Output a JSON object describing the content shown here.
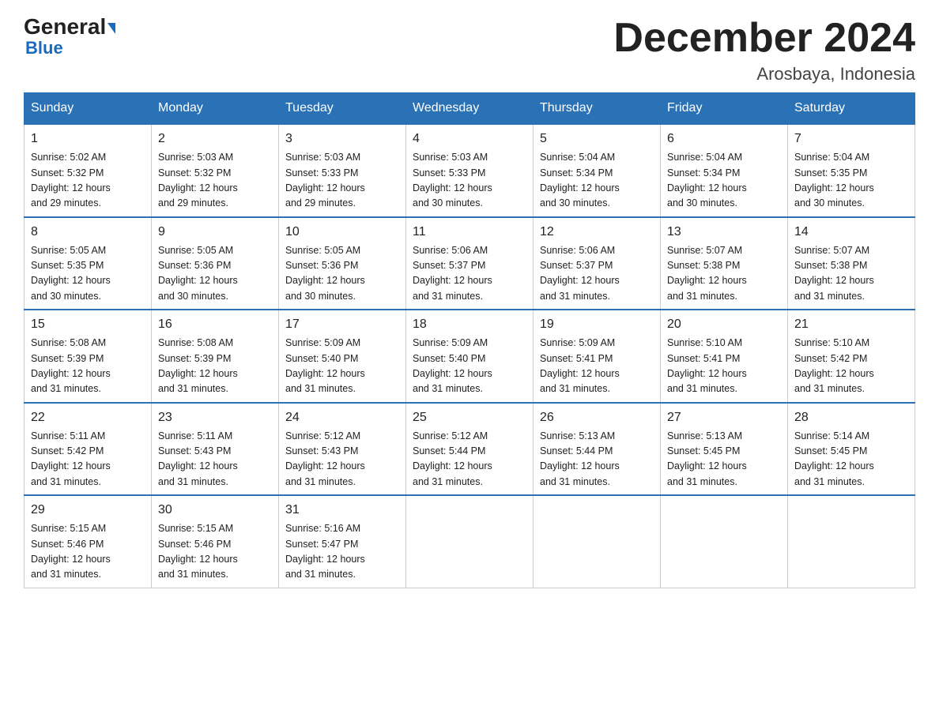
{
  "logo": {
    "general": "General",
    "blue": "Blue"
  },
  "header": {
    "title": "December 2024",
    "subtitle": "Arosbaya, Indonesia"
  },
  "weekdays": [
    "Sunday",
    "Monday",
    "Tuesday",
    "Wednesday",
    "Thursday",
    "Friday",
    "Saturday"
  ],
  "weeks": [
    [
      {
        "day": "1",
        "sunrise": "5:02 AM",
        "sunset": "5:32 PM",
        "daylight": "12 hours and 29 minutes."
      },
      {
        "day": "2",
        "sunrise": "5:03 AM",
        "sunset": "5:32 PM",
        "daylight": "12 hours and 29 minutes."
      },
      {
        "day": "3",
        "sunrise": "5:03 AM",
        "sunset": "5:33 PM",
        "daylight": "12 hours and 29 minutes."
      },
      {
        "day": "4",
        "sunrise": "5:03 AM",
        "sunset": "5:33 PM",
        "daylight": "12 hours and 30 minutes."
      },
      {
        "day": "5",
        "sunrise": "5:04 AM",
        "sunset": "5:34 PM",
        "daylight": "12 hours and 30 minutes."
      },
      {
        "day": "6",
        "sunrise": "5:04 AM",
        "sunset": "5:34 PM",
        "daylight": "12 hours and 30 minutes."
      },
      {
        "day": "7",
        "sunrise": "5:04 AM",
        "sunset": "5:35 PM",
        "daylight": "12 hours and 30 minutes."
      }
    ],
    [
      {
        "day": "8",
        "sunrise": "5:05 AM",
        "sunset": "5:35 PM",
        "daylight": "12 hours and 30 minutes."
      },
      {
        "day": "9",
        "sunrise": "5:05 AM",
        "sunset": "5:36 PM",
        "daylight": "12 hours and 30 minutes."
      },
      {
        "day": "10",
        "sunrise": "5:05 AM",
        "sunset": "5:36 PM",
        "daylight": "12 hours and 30 minutes."
      },
      {
        "day": "11",
        "sunrise": "5:06 AM",
        "sunset": "5:37 PM",
        "daylight": "12 hours and 31 minutes."
      },
      {
        "day": "12",
        "sunrise": "5:06 AM",
        "sunset": "5:37 PM",
        "daylight": "12 hours and 31 minutes."
      },
      {
        "day": "13",
        "sunrise": "5:07 AM",
        "sunset": "5:38 PM",
        "daylight": "12 hours and 31 minutes."
      },
      {
        "day": "14",
        "sunrise": "5:07 AM",
        "sunset": "5:38 PM",
        "daylight": "12 hours and 31 minutes."
      }
    ],
    [
      {
        "day": "15",
        "sunrise": "5:08 AM",
        "sunset": "5:39 PM",
        "daylight": "12 hours and 31 minutes."
      },
      {
        "day": "16",
        "sunrise": "5:08 AM",
        "sunset": "5:39 PM",
        "daylight": "12 hours and 31 minutes."
      },
      {
        "day": "17",
        "sunrise": "5:09 AM",
        "sunset": "5:40 PM",
        "daylight": "12 hours and 31 minutes."
      },
      {
        "day": "18",
        "sunrise": "5:09 AM",
        "sunset": "5:40 PM",
        "daylight": "12 hours and 31 minutes."
      },
      {
        "day": "19",
        "sunrise": "5:09 AM",
        "sunset": "5:41 PM",
        "daylight": "12 hours and 31 minutes."
      },
      {
        "day": "20",
        "sunrise": "5:10 AM",
        "sunset": "5:41 PM",
        "daylight": "12 hours and 31 minutes."
      },
      {
        "day": "21",
        "sunrise": "5:10 AM",
        "sunset": "5:42 PM",
        "daylight": "12 hours and 31 minutes."
      }
    ],
    [
      {
        "day": "22",
        "sunrise": "5:11 AM",
        "sunset": "5:42 PM",
        "daylight": "12 hours and 31 minutes."
      },
      {
        "day": "23",
        "sunrise": "5:11 AM",
        "sunset": "5:43 PM",
        "daylight": "12 hours and 31 minutes."
      },
      {
        "day": "24",
        "sunrise": "5:12 AM",
        "sunset": "5:43 PM",
        "daylight": "12 hours and 31 minutes."
      },
      {
        "day": "25",
        "sunrise": "5:12 AM",
        "sunset": "5:44 PM",
        "daylight": "12 hours and 31 minutes."
      },
      {
        "day": "26",
        "sunrise": "5:13 AM",
        "sunset": "5:44 PM",
        "daylight": "12 hours and 31 minutes."
      },
      {
        "day": "27",
        "sunrise": "5:13 AM",
        "sunset": "5:45 PM",
        "daylight": "12 hours and 31 minutes."
      },
      {
        "day": "28",
        "sunrise": "5:14 AM",
        "sunset": "5:45 PM",
        "daylight": "12 hours and 31 minutes."
      }
    ],
    [
      {
        "day": "29",
        "sunrise": "5:15 AM",
        "sunset": "5:46 PM",
        "daylight": "12 hours and 31 minutes."
      },
      {
        "day": "30",
        "sunrise": "5:15 AM",
        "sunset": "5:46 PM",
        "daylight": "12 hours and 31 minutes."
      },
      {
        "day": "31",
        "sunrise": "5:16 AM",
        "sunset": "5:47 PM",
        "daylight": "12 hours and 31 minutes."
      },
      null,
      null,
      null,
      null
    ]
  ],
  "labels": {
    "sunrise_prefix": "Sunrise: ",
    "sunset_prefix": "Sunset: ",
    "daylight_prefix": "Daylight: "
  }
}
